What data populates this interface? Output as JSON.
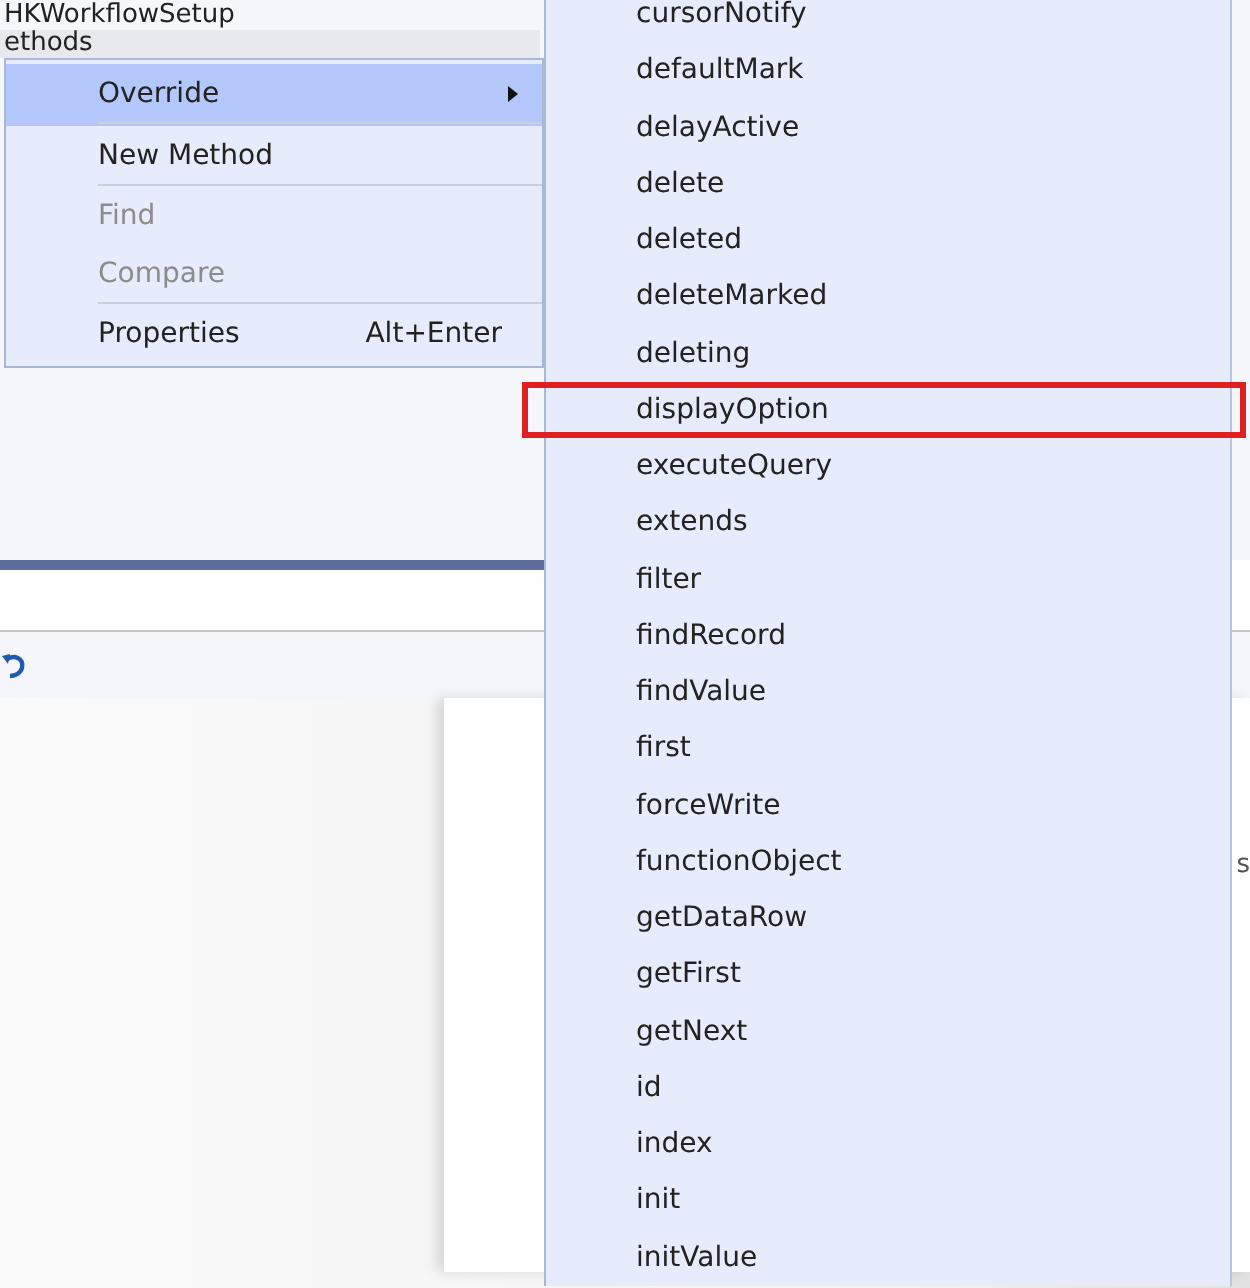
{
  "tree": {
    "items": [
      {
        "label": "HKWorkflowSetup",
        "selected": false
      },
      {
        "label": "ethods",
        "selected": true
      }
    ]
  },
  "context_menu": {
    "items": [
      {
        "label": "Override",
        "submenu": true,
        "disabled": false,
        "selected": true,
        "separator_after": true
      },
      {
        "label": "New Method",
        "submenu": false,
        "disabled": false,
        "selected": false,
        "separator_after": true
      },
      {
        "label": "Find",
        "submenu": false,
        "disabled": true,
        "selected": false,
        "separator_after": false
      },
      {
        "label": "Compare",
        "submenu": false,
        "disabled": true,
        "selected": false,
        "separator_after": true
      },
      {
        "label": "Properties",
        "shortcut": "Alt+Enter",
        "submenu": false,
        "disabled": false,
        "selected": false,
        "separator_after": false
      }
    ]
  },
  "submenu": {
    "items": [
      {
        "label": "cursorNotify",
        "highlighted": false
      },
      {
        "label": "defaultMark",
        "highlighted": false
      },
      {
        "label": "delayActive",
        "highlighted": false
      },
      {
        "label": "delete",
        "highlighted": false
      },
      {
        "label": "deleted",
        "highlighted": false
      },
      {
        "label": "deleteMarked",
        "highlighted": false
      },
      {
        "label": "deleting",
        "highlighted": false
      },
      {
        "label": "displayOption",
        "highlighted": true
      },
      {
        "label": "executeQuery",
        "highlighted": false
      },
      {
        "label": "extends",
        "highlighted": false
      },
      {
        "label": "filter",
        "highlighted": false
      },
      {
        "label": "findRecord",
        "highlighted": false
      },
      {
        "label": "findValue",
        "highlighted": false
      },
      {
        "label": "first",
        "highlighted": false
      },
      {
        "label": "forceWrite",
        "highlighted": false
      },
      {
        "label": "functionObject",
        "highlighted": false
      },
      {
        "label": "getDataRow",
        "highlighted": false
      },
      {
        "label": "getFirst",
        "highlighted": false
      },
      {
        "label": "getNext",
        "highlighted": false
      },
      {
        "label": "id",
        "highlighted": false
      },
      {
        "label": "index",
        "highlighted": false
      },
      {
        "label": "init",
        "highlighted": false
      },
      {
        "label": "initValue",
        "highlighted": false
      }
    ]
  },
  "designer": {
    "card_text": "s"
  }
}
